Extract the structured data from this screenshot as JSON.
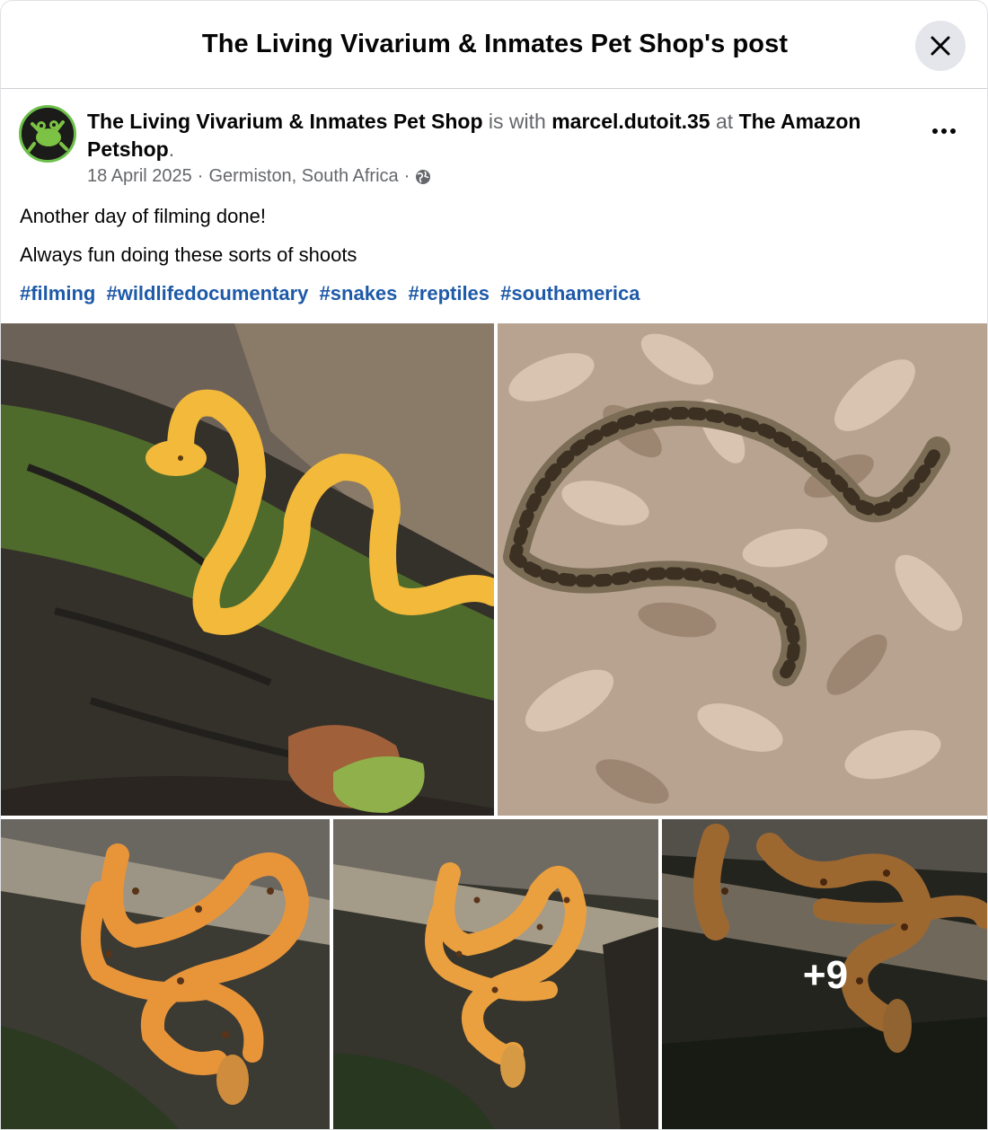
{
  "header": {
    "title": "The Living Vivarium & Inmates Pet Shop's post",
    "close_icon": "close-icon"
  },
  "post": {
    "author": "The Living Vivarium & Inmates Pet Shop",
    "with_text": "is with",
    "tagged_user": "marcel.dutoit.35",
    "at_text": "at",
    "place": "The Amazon Petshop",
    "period": ".",
    "date": "18 April 2025",
    "separator": "·",
    "location": "Germiston, South Africa",
    "privacy_icon": "globe-icon",
    "more_icon": "more-options-icon",
    "lines": [
      "Another day of filming done!",
      "Always fun doing these sorts of shoots"
    ],
    "hashtags": [
      "#filming",
      "#wildlifedocumentary",
      "#snakes",
      "#reptiles",
      "#southamerica"
    ]
  },
  "gallery": {
    "photos": [
      {
        "alt": "yellow-snake-on-mossy-log"
      },
      {
        "alt": "spotted-viper-in-dry-leaves"
      },
      {
        "alt": "orange-tree-boa-on-branch"
      },
      {
        "alt": "orange-tree-boa-on-branch-2"
      },
      {
        "alt": "orange-tree-boa-closeup"
      }
    ],
    "more_count": "+9"
  },
  "colors": {
    "link": "#1e5aa8",
    "muted": "#65676b",
    "close_bg": "#e4e6eb"
  }
}
